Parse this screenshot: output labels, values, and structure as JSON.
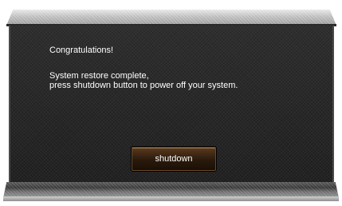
{
  "dialog": {
    "title": "Congratulations!",
    "message_line1": "System restore complete,",
    "message_line2": "press shutdown button to power off your system.",
    "shutdown_label": "shutdown"
  },
  "colors": {
    "dialog_background": "#222222",
    "text": "#ffffff",
    "button": "#3a2412",
    "frame": "#b5b5b5"
  }
}
